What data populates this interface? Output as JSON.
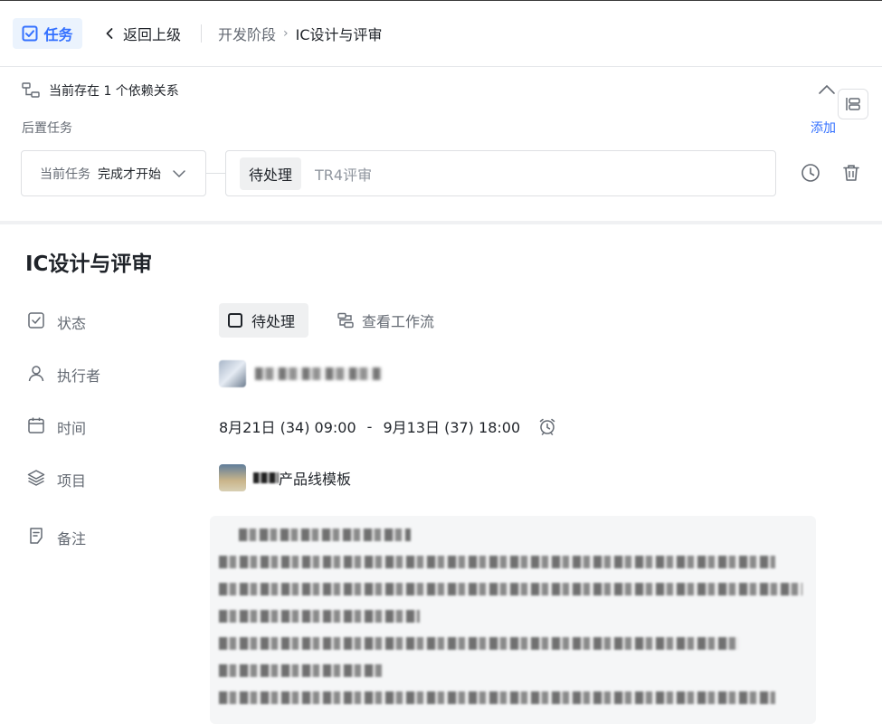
{
  "header": {
    "badge_label": "任务",
    "back_label": "返回上级",
    "breadcrumb": [
      "开发阶段",
      "IC设计与评审"
    ]
  },
  "dependency": {
    "summary": "当前存在 1 个依赖关系",
    "section_label": "后置任务",
    "add_label": "添加",
    "relation_label": "当前任务",
    "relation_value": "完成才开始",
    "task_status": "待处理",
    "task_name": "TR4评审"
  },
  "task": {
    "title": "IC设计与评审",
    "fields": {
      "status_label": "状态",
      "status_value": "待处理",
      "workflow_label": "查看工作流",
      "assignee_label": "执行者",
      "time_label": "时间",
      "time_start": "8月21日 (34) 09:00",
      "time_sep": "-",
      "time_end": "9月13日 (37) 18:00",
      "project_label": "项目",
      "project_value": "产品线模板",
      "notes_label": "备注"
    }
  },
  "colors": {
    "accent": "#3370ff",
    "badge_bg": "#ebf3fd",
    "chip_bg": "#eff0f1",
    "muted_text": "#646a73",
    "notes_bg": "#f5f6f7"
  },
  "icons": {
    "badge": "task-check-icon",
    "back": "chevron-left-icon",
    "dependency": "dependency-icon",
    "collapse": "chevron-up-icon",
    "side_panel": "layout-panel-icon",
    "relation_dropdown": "chevron-down-icon",
    "history": "clock-icon",
    "delete": "trash-icon",
    "status": "checkbox-icon",
    "workflow": "workflow-icon",
    "assignee": "person-icon",
    "time": "calendar-icon",
    "reminder": "alarm-icon",
    "project": "layers-icon",
    "notes": "notes-icon"
  }
}
